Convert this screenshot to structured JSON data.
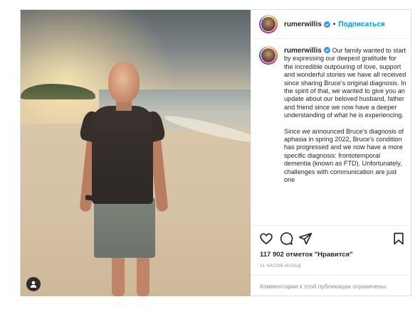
{
  "post": {
    "username": "rumerwillis",
    "follow_label": "Подписаться",
    "separator": "•",
    "caption_paragraphs": [
      "Our family wanted to start by expressing our deepest gratitude for the incredible outpouring of love, support and wonderful stories we have all received since sharing Bruce's original diagnosis. In the spirit of that, we wanted to give you an update about our beloved husband, father and friend since we now have a deeper understanding of what he is experiencing.",
      "Since we announced Bruce's diagnosis of aphasia in spring 2022, Bruce's condition has progressed and we now have a more specific diagnosis: frontotemporal dementia (known as FTD). Unfortunately, challenges with communication are just one"
    ],
    "likes_text": "117 902 отметок \"Нравится\"",
    "time_text": "11 часов назад",
    "comments_disabled_text": "Комментарии к этой публикации ограничены."
  },
  "colors": {
    "accent": "#0095f6",
    "verified": "#3897f0",
    "muted": "#8e8e8e",
    "text": "#262626"
  },
  "icons": [
    "verified-badge-icon",
    "heart-icon",
    "comment-icon",
    "share-icon",
    "bookmark-icon",
    "user-tag-icon"
  ]
}
